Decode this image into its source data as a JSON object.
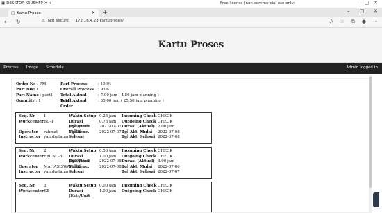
{
  "rd_bar": {
    "host": "DESKTOP-K6U5HFP",
    "license": "Free license (non-commercial use only)"
  },
  "browser": {
    "tab_title": "Kartu Proses",
    "address_security": "Not secure",
    "address_url": "172.16.4.23/kartuproses/"
  },
  "page": {
    "title": "Kartu Proses"
  },
  "menu": {
    "items": [
      "Process",
      "Image",
      "Schedule"
    ],
    "admin": "Admin logged in"
  },
  "summary": {
    "order_no": "Order No",
    "order_no_val": ": PM 22.0.0059",
    "part_process": "Part Process",
    "part_process_val": ": 100%",
    "part_no": "Part No",
    "part_no_val": ": 1",
    "overall_process": "Overall Process",
    "overall_process_val": ": 93%",
    "part_name": "Part Name",
    "part_name_val": ": part1",
    "total_aktual": "Total Aktual Part",
    "total_aktual_val": ": 7.00 jam   ( 4.50 jam  planning )",
    "quantity": "Quantity",
    "quantity_val": ": 1",
    "total_order": "Total Aktual Order",
    "total_order_val": ": 35.00 jam ( 25.50 jam planning )"
  },
  "cards": [
    {
      "seq": "1",
      "workcenter": "BU-1",
      "operator": "rahmat",
      "instructor": "yanidratama",
      "waktu_setup": "0.25 jam",
      "durasi_est": "0.75 jam",
      "tgl_renc_mulai": "2022-07-07",
      "tgl_renc_selesai": "2022-07-07",
      "incoming": "CHECK",
      "outgoing": "CHECK",
      "durasi_aktual": "2.00 jam",
      "tgl_akt_mulai": "2022-07-08",
      "tgl_akt_selesai": "2022-07-08"
    },
    {
      "seq": "2",
      "workcenter": "FRCNC-5",
      "operator": "MAHASISWA",
      "instructor": "yanidratama",
      "waktu_setup": "0.50 jam",
      "durasi_est": "1.00 jam",
      "tgl_renc_mulai": "2022-07-08",
      "tgl_renc_selesai": "2022-07-08",
      "incoming": "CHECK",
      "outgoing": "CHECK",
      "durasi_aktual": "3.00 jam",
      "tgl_akt_mulai": "2022-07-06",
      "tgl_akt_selesai": "2022-07-07"
    },
    {
      "seq": "3",
      "workcenter": "KB",
      "waktu_setup": "0.00 jam",
      "durasi_est": "1.00 jam",
      "incoming": "CHECK",
      "outgoing": "CHECK"
    }
  ],
  "labels": {
    "seq": "Seq. Nr",
    "workcenter": "Workcenter",
    "operator": "Operator",
    "instructor": "Instructor",
    "waktu_setup": "Waktu Setup",
    "durasi_est": "Durasi (Est)/Unit",
    "tgl_renc_mulai": "Tgl Renc. Mulai",
    "tgl_renc_selesai": "Tgl Renc. Selesai",
    "incoming": "Incoming Check",
    "outgoing": "Outgoing Check",
    "durasi_aktual": "Durasi (Aktual)",
    "tgl_akt_mulai": "Tgl Akt. Mulai",
    "tgl_akt_selesai": "Tgl Akt. Selesai"
  }
}
